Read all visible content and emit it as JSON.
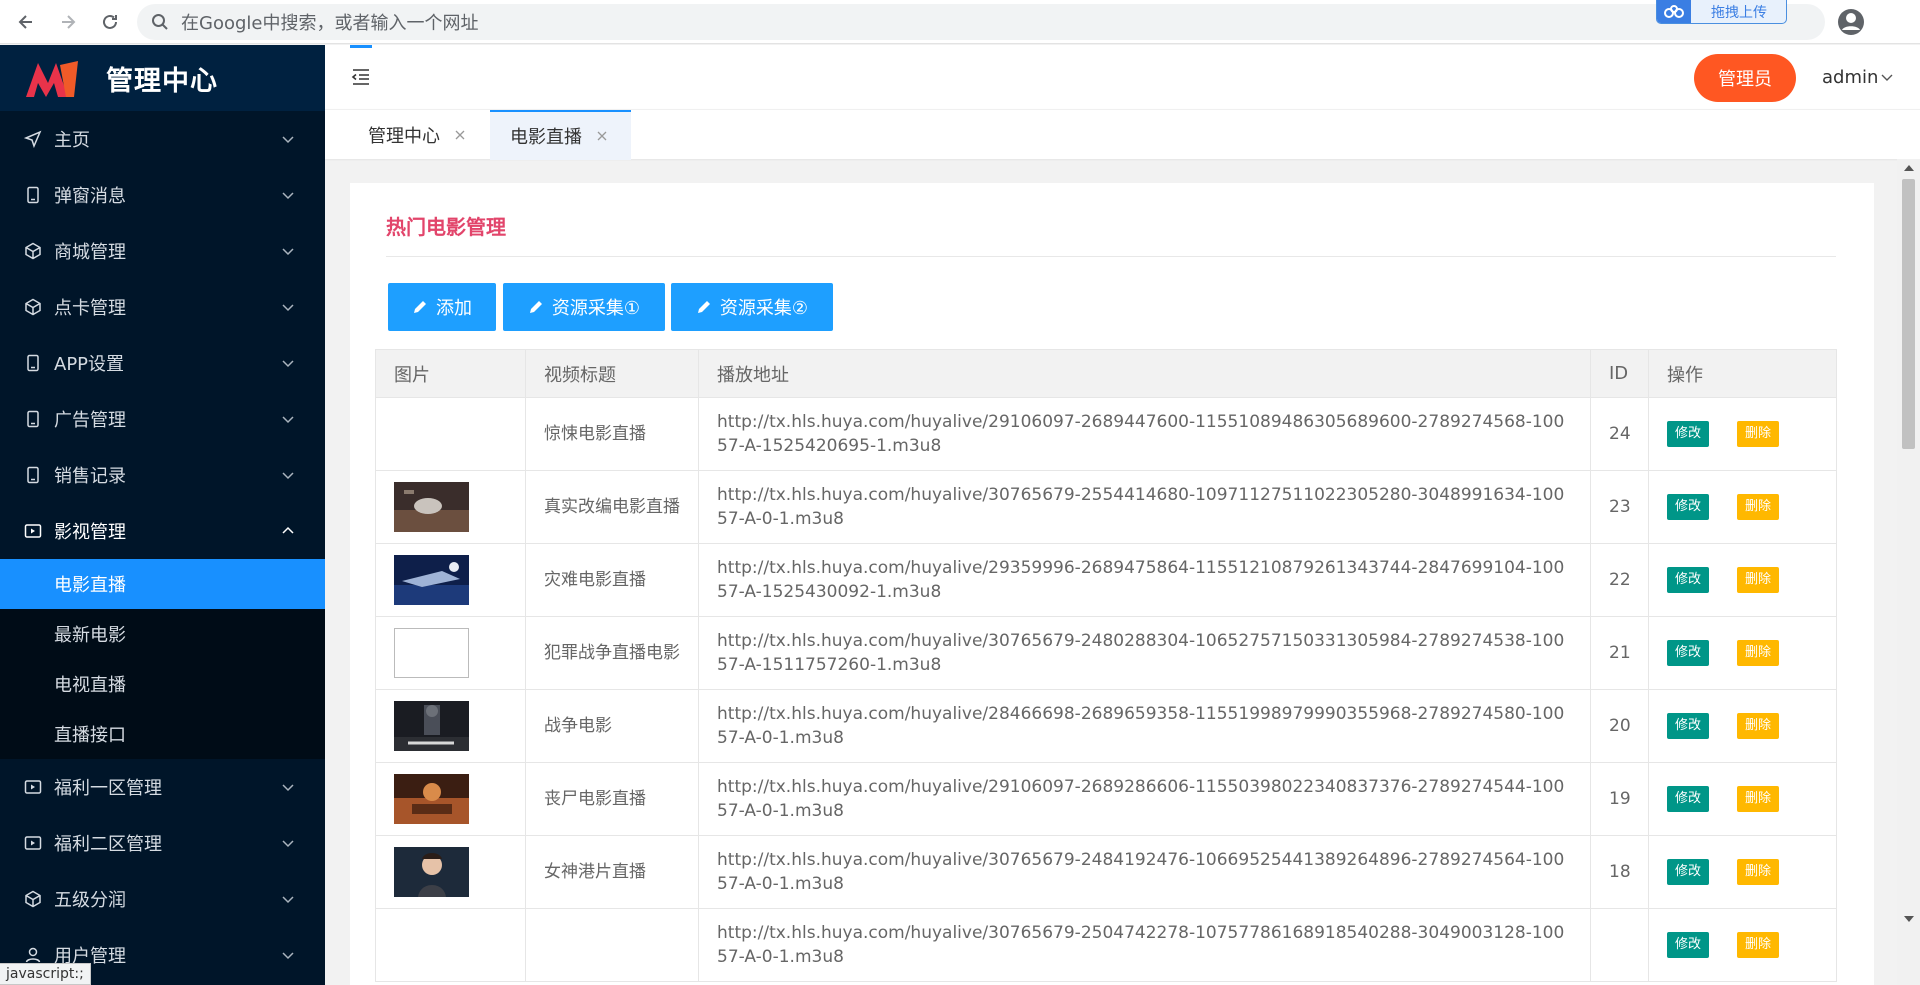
{
  "browser": {
    "address_placeholder": "在Google中搜索，或者输入一个网址",
    "upload_label": "拖拽上传"
  },
  "sidebar": {
    "title": "管理中心",
    "items": [
      {
        "label": "主页",
        "icon": "send-icon"
      },
      {
        "label": "弹窗消息",
        "icon": "tablet-icon"
      },
      {
        "label": "商城管理",
        "icon": "cube-icon"
      },
      {
        "label": "点卡管理",
        "icon": "cube-icon"
      },
      {
        "label": "APP设置",
        "icon": "tablet-icon"
      },
      {
        "label": "广告管理",
        "icon": "tablet-icon"
      },
      {
        "label": "销售记录",
        "icon": "tablet-icon"
      },
      {
        "label": "影视管理",
        "icon": "video-icon"
      }
    ],
    "sub_items": [
      {
        "label": "电影直播",
        "active": true
      },
      {
        "label": "最新电影"
      },
      {
        "label": "电视直播"
      },
      {
        "label": "直播接口"
      }
    ],
    "items_after": [
      {
        "label": "福利一区管理",
        "icon": "video-icon"
      },
      {
        "label": "福利二区管理",
        "icon": "video-icon"
      },
      {
        "label": "五级分润",
        "icon": "cube-icon"
      },
      {
        "label": "用户管理",
        "icon": "user-icon"
      }
    ]
  },
  "status_bar": {
    "text": "javascript:;"
  },
  "header": {
    "role": "管理员",
    "user": "admin"
  },
  "tabs": [
    {
      "label": "管理中心"
    },
    {
      "label": "电影直播",
      "active": true
    }
  ],
  "card": {
    "title": "热门电影管理",
    "buttons": [
      "添加",
      "资源采集①",
      "资源采集②"
    ]
  },
  "table": {
    "columns": [
      "图片",
      "视频标题",
      "播放地址",
      "ID",
      "操作"
    ],
    "edit_label": "修改",
    "delete_label": "删除",
    "rows": [
      {
        "image": "none",
        "title": "惊悚电影直播",
        "url": "http://tx.hls.huya.com/huyalive/29106097-2689447600-11551089486305689600-2789274568-10057-A-1525420695-1.m3u8",
        "id": "24"
      },
      {
        "image": "poster",
        "title": "真实改编电影直播",
        "url": "http://tx.hls.huya.com/huyalive/30765679-2554414680-10971127511022305280-3048991634-10057-A-0-1.m3u8",
        "id": "23"
      },
      {
        "image": "poster",
        "title": "灾难电影直播",
        "url": "http://tx.hls.huya.com/huyalive/29359996-2689475864-11551210879261343744-2847699104-10057-A-1525430092-1.m3u8",
        "id": "22"
      },
      {
        "image": "broken",
        "title": "犯罪战争直播电影",
        "url": "http://tx.hls.huya.com/huyalive/30765679-2480288304-10652757150331305984-2789274538-10057-A-1511757260-1.m3u8",
        "id": "21"
      },
      {
        "image": "poster",
        "title": "战争电影",
        "url": "http://tx.hls.huya.com/huyalive/28466698-2689659358-11551998979990355968-2789274580-10057-A-0-1.m3u8",
        "id": "20"
      },
      {
        "image": "poster",
        "title": "丧尸电影直播",
        "url": "http://tx.hls.huya.com/huyalive/29106097-2689286606-11550398022340837376-2789274544-10057-A-0-1.m3u8",
        "id": "19"
      },
      {
        "image": "poster",
        "title": "女神港片直播",
        "url": "http://tx.hls.huya.com/huyalive/30765679-2484192476-10669525441389264896-2789274564-10057-A-0-1.m3u8",
        "id": "18"
      },
      {
        "image": "none",
        "title": "",
        "url": "http://tx.hls.huya.com/huyalive/30765679-2504742278-10757786168918540288-3049003128-10057-A-0-1.m3u8",
        "id": ""
      }
    ]
  },
  "colors": {
    "sidebar_bg": "#001529",
    "active": "#1890ff",
    "role_button": "#ff5722",
    "title": "#e2456b",
    "edit": "#009688",
    "delete": "#ffb800"
  }
}
